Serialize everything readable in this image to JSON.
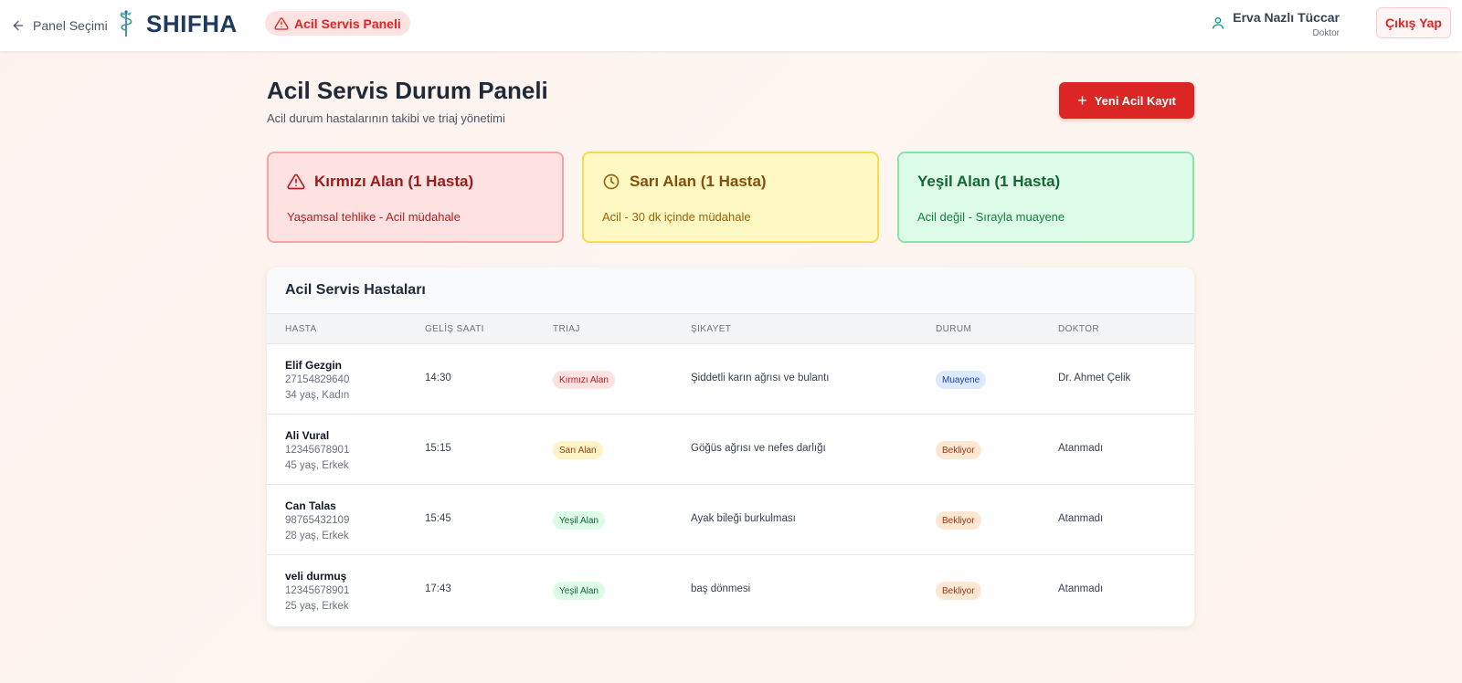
{
  "header": {
    "back_label": "Panel Seçimi",
    "brand": "SHIFHA",
    "panel_badge": "Acil Servis Paneli",
    "user_name": "Erva Nazlı Tüccar",
    "user_role": "Doktor",
    "logout_label": "Çıkış Yap"
  },
  "page": {
    "title": "Acil Servis Durum Paneli",
    "subtitle": "Acil durum hastalarının takibi ve triaj yönetimi",
    "new_button": "Yeni Acil Kayıt"
  },
  "cards": [
    {
      "title": "Kırmızı Alan (1 Hasta)",
      "desc": "Yaşamsal tehlike - Acil müdahale",
      "icon": "warning-triangle-icon"
    },
    {
      "title": "Sarı Alan (1 Hasta)",
      "desc": "Acil - 30 dk içinde müdahale",
      "icon": "clock-icon"
    },
    {
      "title": "Yeşil Alan (1 Hasta)",
      "desc": "Acil değil - Sırayla muayene"
    }
  ],
  "table": {
    "title": "Acil Servis Hastaları",
    "columns": [
      "HASTA",
      "GELİŞ SAATI",
      "TRIAJ",
      "ŞIKAYET",
      "DURUM",
      "DOKTOR"
    ],
    "rows": [
      {
        "name": "Elif Gezgin",
        "id": "27154829640",
        "info": "34 yaş, Kadın",
        "time": "14:30",
        "triage": "Kırmızı Alan",
        "complaint": "Şiddetli karın ağrısı ve bulantı",
        "status": "Muayene",
        "doctor": "Dr. Ahmet Çelik"
      },
      {
        "name": "Ali Vural",
        "id": "12345678901",
        "info": "45 yaş, Erkek",
        "time": "15:15",
        "triage": "Sarı Alan",
        "complaint": "Göğüs ağrısı ve nefes darlığı",
        "status": "Bekliyor",
        "doctor": "Atanmadı"
      },
      {
        "name": "Can Talas",
        "id": "98765432109",
        "info": "28 yaş, Erkek",
        "time": "15:45",
        "triage": "Yeşil Alan",
        "complaint": "Ayak bileği burkulması",
        "status": "Bekliyor",
        "doctor": "Atanmadı"
      },
      {
        "name": "veli durmuş",
        "id": "12345678901",
        "info": "25 yaş, Erkek",
        "time": "17:43",
        "triage": "Yeşil Alan",
        "complaint": "baş dönmesi",
        "status": "Bekliyor",
        "doctor": "Atanmadı"
      }
    ]
  },
  "colors": {
    "accent_red": "#dc2626",
    "brand_navy": "#1e3a5f",
    "red_zone": "#fee2e2",
    "yellow_zone": "#fef9c3",
    "green_zone": "#dcfce7"
  }
}
